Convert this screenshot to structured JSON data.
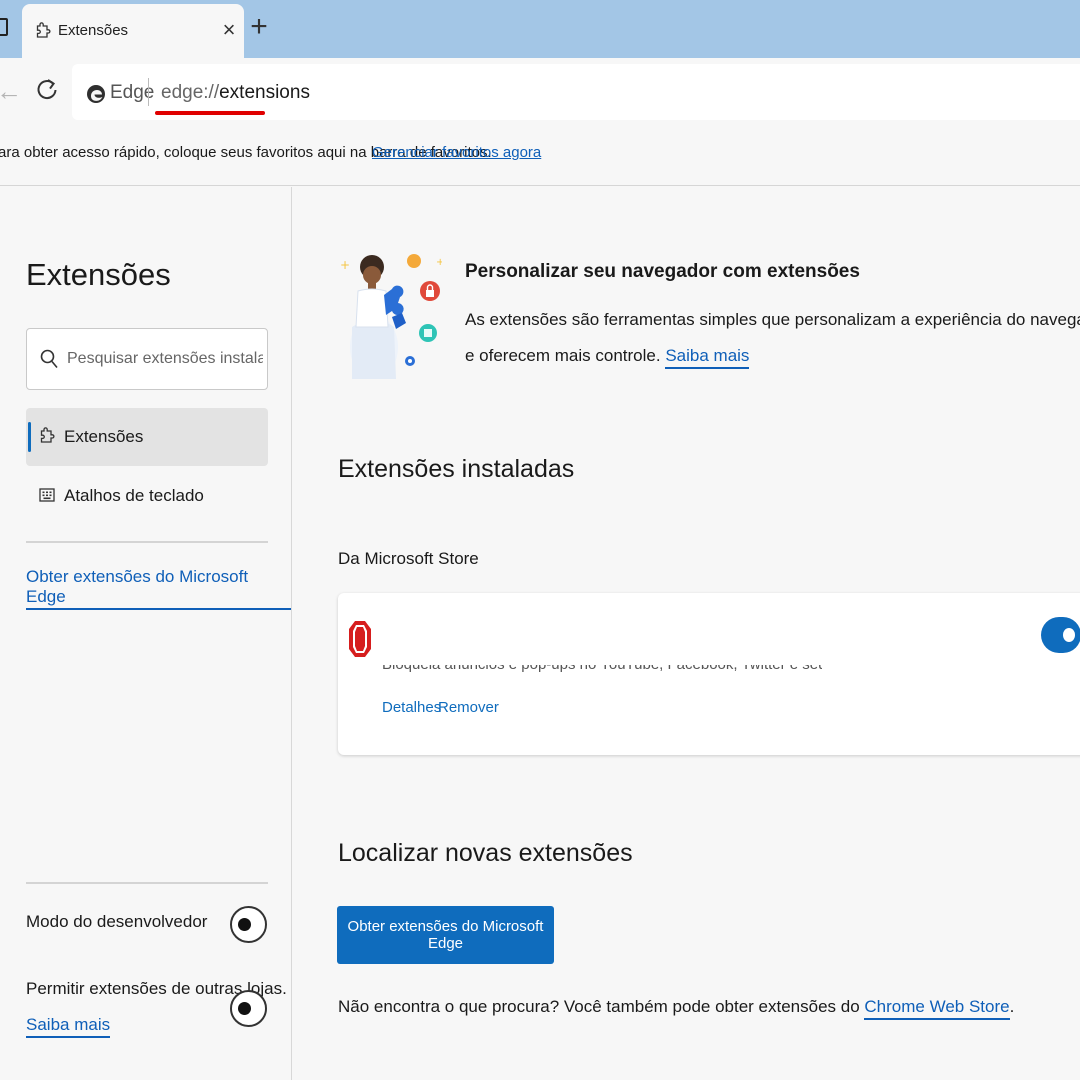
{
  "browser": {
    "tab": {
      "title": "Extensões",
      "icon": "puzzle-icon",
      "close_glyph": "×"
    },
    "new_tab_glyph": "+",
    "back_glyph": "←",
    "address": {
      "brand": "Edge",
      "url_scheme": "edge://",
      "url_path": "extensions",
      "underline_color": "#e00000"
    },
    "favorites_bar": {
      "text": "ara obter acesso rápido, coloque seus favoritos aqui na barra de favoritos.",
      "link": "Gerenciar favoritos agora"
    }
  },
  "sidebar": {
    "title": "Extensões",
    "search": {
      "placeholder": "Pesquisar extensões instaladas",
      "value": ""
    },
    "nav": [
      {
        "label": "Extensões",
        "icon": "puzzle-icon",
        "active": true
      },
      {
        "label": "Atalhos de teclado",
        "icon": "keyboard-icon",
        "active": false
      }
    ],
    "get_extensions_link": "Obter extensões do Microsoft Edge",
    "developer_mode": {
      "label": "Modo do desenvolvedor",
      "enabled": false
    },
    "other_stores": {
      "label": "Permitir extensões de outras lojas.",
      "link": "Saiba mais",
      "enabled": false
    }
  },
  "main": {
    "hero": {
      "title": "Personalizar seu navegador com extensões",
      "line1": "As extensões são ferramentas simples que personalizam a experiência do navegador",
      "line2": "e oferecem mais controle.",
      "link": "Saiba mais"
    },
    "installed_heading": "Extensões instaladas",
    "store_label": "Da Microsoft Store",
    "extension": {
      "icon": "stop-sign-icon",
      "description": "Bloqueia anúncios e pop-ups no YouTube, Facebook, Twitter e seus sites favoritos.",
      "details_link": "Detalhes",
      "remove_link": "Remover",
      "enabled": true
    },
    "find_heading": "Localizar novas extensões",
    "get_button": "Obter extensões do Microsoft Edge",
    "footer": {
      "text": "Não encontra o que procura? Você também pode obter extensões do ",
      "link": "Chrome Web Store",
      "end": "."
    }
  },
  "colors": {
    "accent": "#0f6cbd",
    "link": "#0f5fb8",
    "tabstrip": "#a3c6e6",
    "page_bg": "#f7f7f7"
  }
}
